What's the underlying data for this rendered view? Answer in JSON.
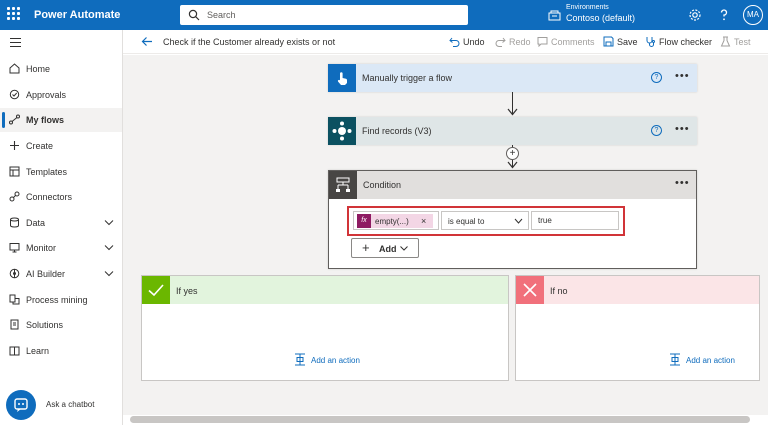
{
  "app": {
    "title": "Power Automate",
    "avatar_initials": "MA"
  },
  "search": {
    "placeholder": "Search"
  },
  "environment": {
    "label": "Environments",
    "name": "Contoso (default)"
  },
  "sidebar": {
    "items": [
      {
        "label": "Home",
        "icon": "home-icon"
      },
      {
        "label": "Approvals",
        "icon": "approvals-icon"
      },
      {
        "label": "My flows",
        "icon": "flows-icon",
        "active": true
      },
      {
        "label": "Create",
        "icon": "plus-icon"
      },
      {
        "label": "Templates",
        "icon": "templates-icon"
      },
      {
        "label": "Connectors",
        "icon": "connectors-icon"
      },
      {
        "label": "Data",
        "icon": "database-icon",
        "expandable": true
      },
      {
        "label": "Monitor",
        "icon": "monitor-icon",
        "expandable": true
      },
      {
        "label": "AI Builder",
        "icon": "ai-builder-icon",
        "expandable": true
      },
      {
        "label": "Process mining",
        "icon": "process-mining-icon"
      },
      {
        "label": "Solutions",
        "icon": "solutions-icon"
      },
      {
        "label": "Learn",
        "icon": "learn-icon"
      }
    ],
    "chatbot_label": "Ask a chatbot"
  },
  "commandbar": {
    "flow_name": "Check if the Customer already exists or not",
    "undo": "Undo",
    "redo": "Redo",
    "comments": "Comments",
    "save": "Save",
    "flow_checker": "Flow checker",
    "test": "Test"
  },
  "flow": {
    "trigger": {
      "title": "Manually trigger a flow",
      "color": "#0f6cbd"
    },
    "action": {
      "title": "Find records (V3)",
      "color": "#0b5161"
    },
    "condition": {
      "title": "Condition",
      "left_token": "empty(...)",
      "operator": "is equal to",
      "right_value": "true",
      "add_label": "Add"
    },
    "branch_yes": {
      "title": "If yes",
      "add_action": "Add an action",
      "color": "#6bb700"
    },
    "branch_no": {
      "title": "If no",
      "add_action": "Add an action",
      "color": "#f1707b"
    }
  }
}
